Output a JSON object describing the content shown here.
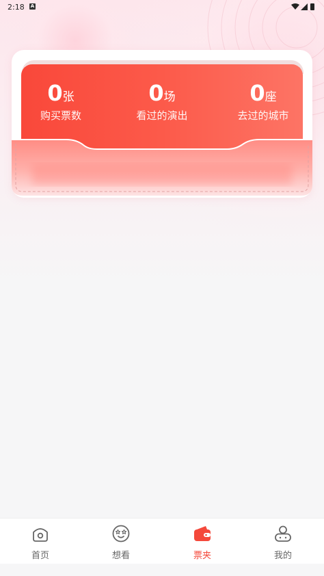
{
  "status_bar": {
    "time": "2:18",
    "badge": "A"
  },
  "stats": [
    {
      "number": "0",
      "unit": "张",
      "label": "购买票数"
    },
    {
      "number": "0",
      "unit": "场",
      "label": "看过的演出"
    },
    {
      "number": "0",
      "unit": "座",
      "label": "去过的城市"
    }
  ],
  "nav": {
    "active_color": "#f4493b",
    "items": [
      {
        "label": "首页",
        "icon": "home-icon"
      },
      {
        "label": "想看",
        "icon": "star-eyes-face-icon"
      },
      {
        "label": "票夹",
        "icon": "wallet-icon",
        "active": true
      },
      {
        "label": "我的",
        "icon": "profile-icon"
      }
    ]
  }
}
